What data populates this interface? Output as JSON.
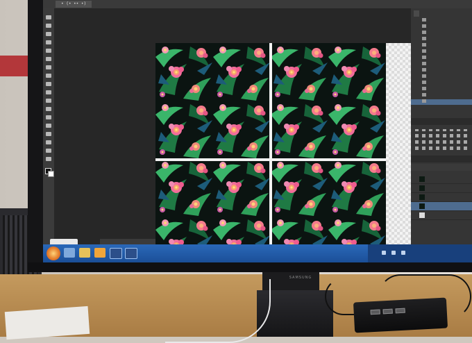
{
  "photo": {
    "subject": "Computer monitor displaying an image-editing application with a tiled floral pattern",
    "monitor_brand": "SAMSUNG"
  },
  "photoshop": {
    "document_tab": "• (• •• •)",
    "canvas": {
      "pattern": "tropical leaves and pink hibiscus on dark background",
      "tiles": 4,
      "guides": [
        "vertical",
        "horizontal"
      ]
    },
    "history_panel": {
      "items": [
        {
          "selected": false
        },
        {
          "selected": false
        },
        {
          "selected": false
        },
        {
          "selected": false
        },
        {
          "selected": false
        },
        {
          "selected": false
        },
        {
          "selected": false
        },
        {
          "selected": false
        },
        {
          "selected": false
        },
        {
          "selected": false
        },
        {
          "selected": false
        },
        {
          "selected": false
        },
        {
          "selected": false
        },
        {
          "selected": true
        }
      ]
    },
    "layers_panel": {
      "layers": [
        {
          "selected": false
        },
        {
          "selected": false
        },
        {
          "selected": false
        },
        {
          "selected": true
        },
        {
          "selected": false
        }
      ]
    }
  },
  "taskbar": {
    "apps": [
      "ie-icon",
      "folder-icon",
      "media-icon",
      "photoshop-icon",
      "photoshop-icon"
    ]
  },
  "colors": {
    "taskbar": "#1b4f98",
    "ps_background": "#282828",
    "pattern_base": "#0b1411",
    "flower": "#f26d9a",
    "leaf": "#2fa05a"
  }
}
